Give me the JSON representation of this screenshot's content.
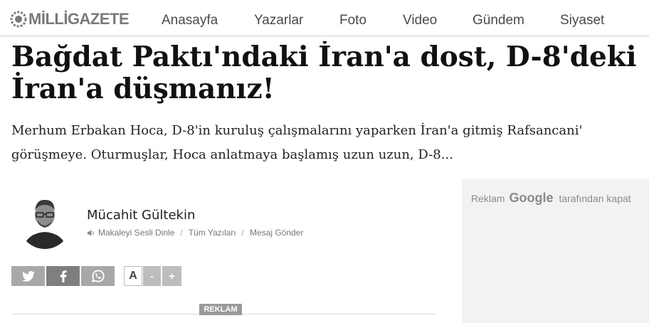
{
  "header": {
    "logo_text": "MİLLİGAZETE",
    "nav": [
      "Anasayfa",
      "Yazarlar",
      "Foto",
      "Video",
      "Gündem",
      "Siyaset"
    ]
  },
  "article": {
    "headline_line1": "Bağdat Paktı'ndaki İran'a dost, D-8'deki",
    "headline_line2": "İran'a düşmanız!",
    "summary_line1": "Merhum Erbakan Hoca, D-8'in kuruluş çalışmalarını yaparken İran'a gitmiş Rafsancani'",
    "summary_line2": "görüşmeye. Oturmuşlar, Hoca anlatmaya başlamış uzun uzun, D-8..."
  },
  "author": {
    "name": "Mücahit Gültekin",
    "listen_label": "Makaleyi Sesli Dinle",
    "all_posts_label": "Tüm Yazıları",
    "message_label": "Mesaj Gönder",
    "separator": "/"
  },
  "share": {
    "icons": [
      "twitter-icon",
      "facebook-icon",
      "whatsapp-icon"
    ]
  },
  "font_controls": {
    "a_label": "A",
    "minus_label": "-",
    "plus_label": "+"
  },
  "ad": {
    "reklam_badge": "REKLAM",
    "prefix": "Reklam",
    "brand": "Google",
    "suffix": "tarafından kapat"
  },
  "colors": {
    "share_gray": "#a8a8a8",
    "share_dark": "#7f7f7f",
    "ad_bg": "#f2f2f2"
  }
}
